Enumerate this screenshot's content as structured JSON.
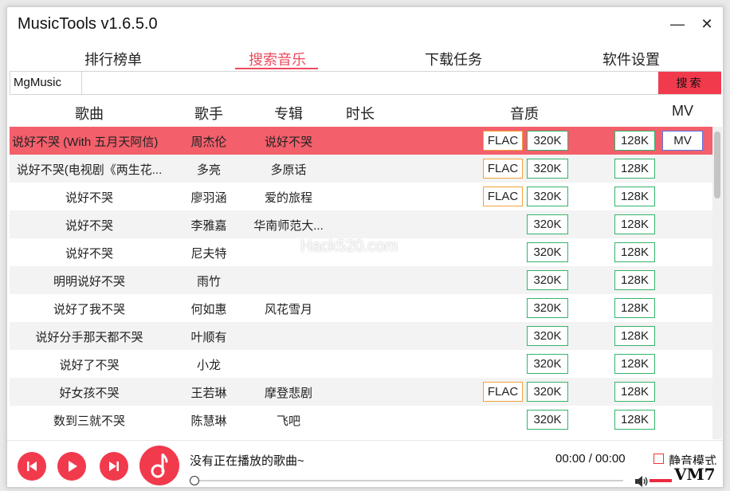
{
  "window": {
    "title": "MusicTools v1.6.5.0",
    "minimize_glyph": "—",
    "close_glyph": "✕"
  },
  "tabs": [
    {
      "label": "排行榜单",
      "active": false
    },
    {
      "label": "搜索音乐",
      "active": true
    },
    {
      "label": "下载任务",
      "active": false
    },
    {
      "label": "软件设置",
      "active": false
    }
  ],
  "search": {
    "source": "MgMusic",
    "value": "",
    "button_label": "搜索"
  },
  "columns": {
    "song": "歌曲",
    "artist": "歌手",
    "album": "专辑",
    "duration": "时长",
    "quality": "音质",
    "mv": "MV"
  },
  "rows": [
    {
      "song": "说好不哭 (With 五月天阿信)",
      "artist": "周杰伦",
      "album": "说好不哭",
      "flac": "FLAC",
      "q320": "320K",
      "q128": "128K",
      "mv": "MV",
      "selected": true
    },
    {
      "song": "说好不哭(电视剧《两生花...",
      "artist": "多亮",
      "album": "多原话",
      "flac": "FLAC",
      "q320": "320K",
      "q128": "128K"
    },
    {
      "song": "说好不哭",
      "artist": "廖羽涵",
      "album": "爱的旅程",
      "flac": "FLAC",
      "q320": "320K",
      "q128": "128K"
    },
    {
      "song": "说好不哭",
      "artist": "李雅嘉",
      "album": "华南师范大...",
      "q320": "320K",
      "q128": "128K"
    },
    {
      "song": "说好不哭",
      "artist": "尼夫特",
      "album": "",
      "q320": "320K",
      "q128": "128K"
    },
    {
      "song": "明明说好不哭",
      "artist": "雨竹",
      "album": "",
      "q320": "320K",
      "q128": "128K"
    },
    {
      "song": "说好了我不哭",
      "artist": "何如惠",
      "album": "风花雪月",
      "q320": "320K",
      "q128": "128K"
    },
    {
      "song": "说好分手那天都不哭",
      "artist": "叶顺有",
      "album": "",
      "q320": "320K",
      "q128": "128K"
    },
    {
      "song": "说好了不哭",
      "artist": "小龙",
      "album": "",
      "q320": "320K",
      "q128": "128K"
    },
    {
      "song": "好女孩不哭",
      "artist": "王若琳",
      "album": "摩登悲剧",
      "flac": "FLAC",
      "q320": "320K",
      "q128": "128K"
    },
    {
      "song": "数到三就不哭",
      "artist": "陈慧琳",
      "album": "飞吧",
      "q320": "320K",
      "q128": "128K"
    }
  ],
  "watermark": "Hack520.com",
  "player": {
    "now_playing": "没有正在播放的歌曲~",
    "time": "00:00 / 00:00",
    "mute_label": "静音模式",
    "progress_fraction": 0,
    "volume_fraction": 1
  },
  "badge": "VM7",
  "colors": {
    "accent": "#f23a4d",
    "selected_row": "#f35f6b",
    "flac_border": "#f3a23a",
    "kbps_border": "#34b36b",
    "mv_border": "#5b74e0"
  }
}
